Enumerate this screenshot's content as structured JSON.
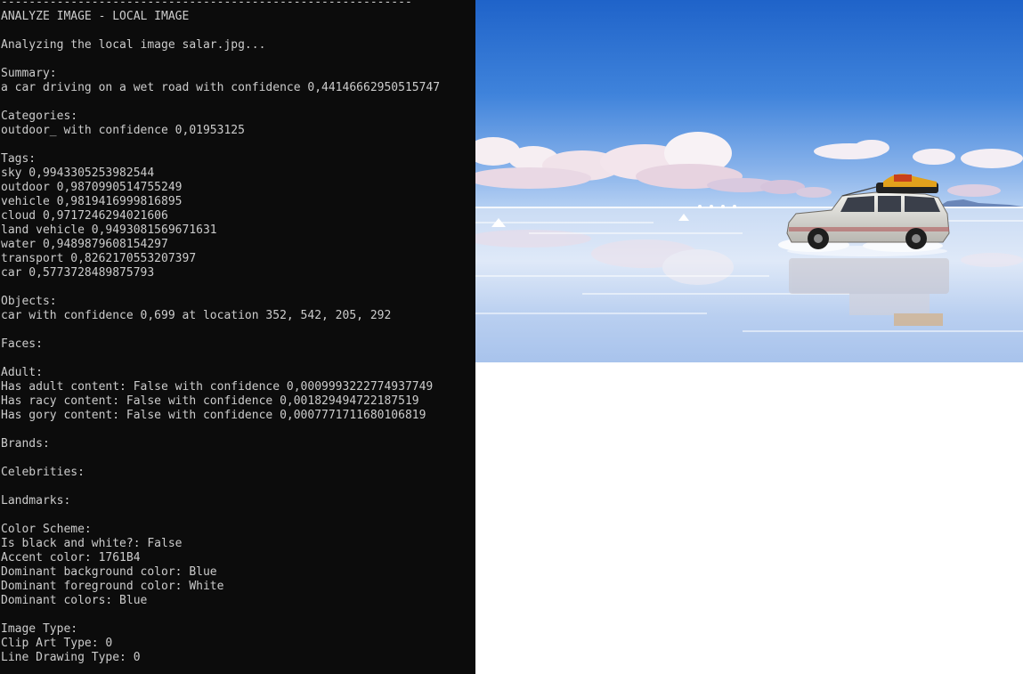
{
  "console": {
    "lines": [
      "-----------------------------------------------------------",
      "ANALYZE IMAGE - LOCAL IMAGE",
      "",
      "Analyzing the local image salar.jpg...",
      "",
      "Summary:",
      "a car driving on a wet road with confidence 0,44146662950515747",
      "",
      "Categories:",
      "outdoor_ with confidence 0,01953125",
      "",
      "Tags:",
      "sky 0,9943305253982544",
      "outdoor 0,9870990514755249",
      "vehicle 0,9819416999816895",
      "cloud 0,9717246294021606",
      "land vehicle 0,9493081569671631",
      "water 0,9489879608154297",
      "transport 0,8262170553207397",
      "car 0,5773728489875793",
      "",
      "Objects:",
      "car with confidence 0,699 at location 352, 542, 205, 292",
      "",
      "Faces:",
      "",
      "Adult:",
      "Has adult content: False with confidence 0,0009993222774937749",
      "Has racy content: False with confidence 0,001829494722187519",
      "Has gory content: False with confidence 0,0007771711680106819",
      "",
      "Brands:",
      "",
      "Celebrities:",
      "",
      "Landmarks:",
      "",
      "Color Scheme:",
      "Is black and white?: False",
      "Accent color: 1761B4",
      "Dominant background color: Blue",
      "Dominant foreground color: White",
      "Dominant colors: Blue",
      "",
      "Image Type:",
      "Clip Art Type: 0",
      "Line Drawing Type: 0"
    ]
  },
  "photo": {
    "accent_color": "#1761B4",
    "sky_top": "#1f63c9",
    "sky_horizon": "#9fc3f0",
    "salt_flat": "#dce8f8"
  }
}
